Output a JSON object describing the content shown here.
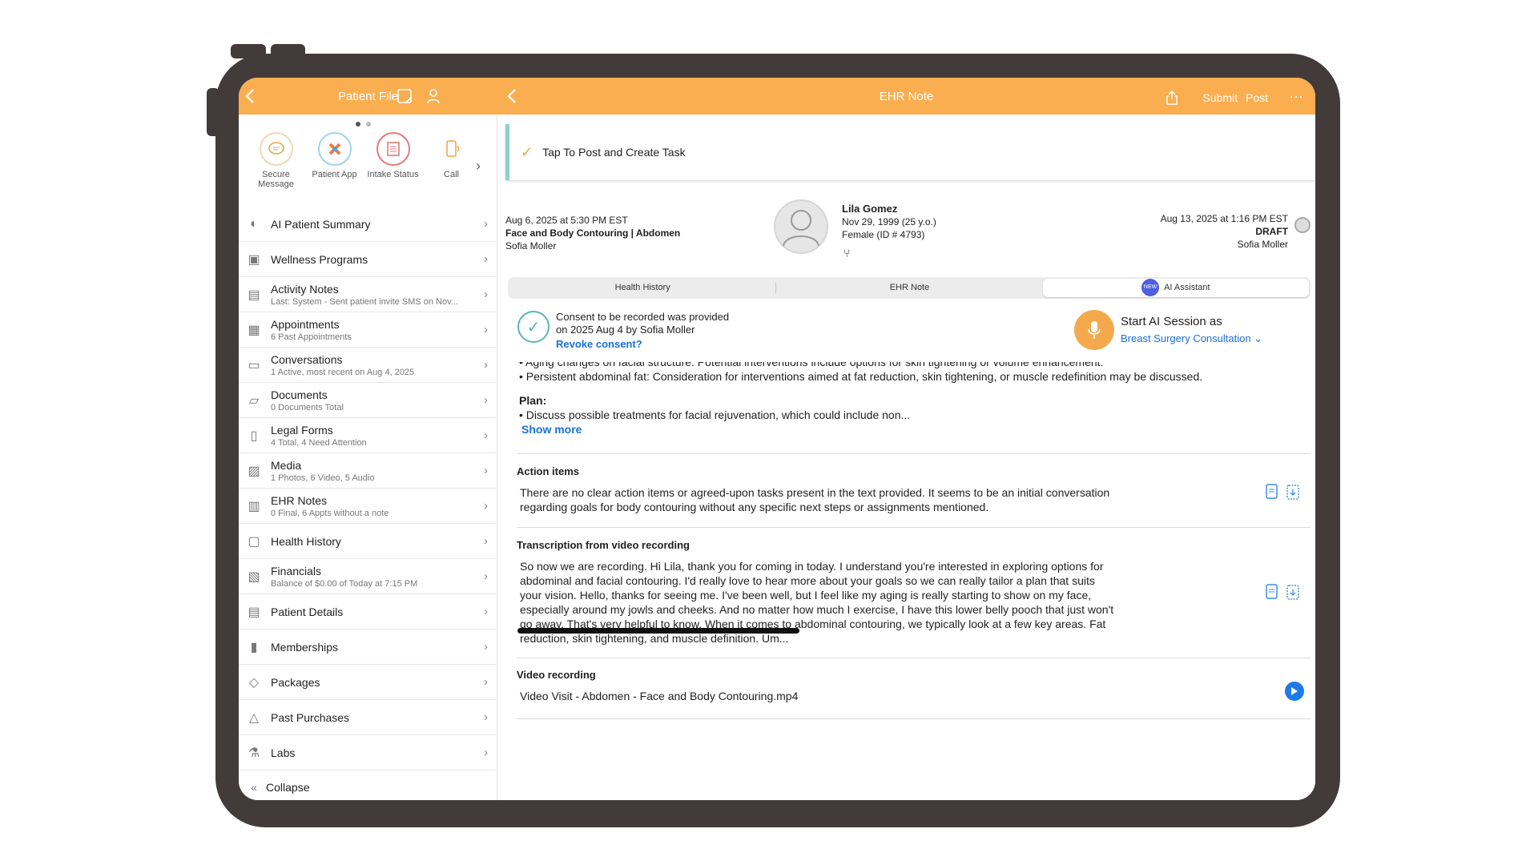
{
  "left": {
    "title": "Patient File",
    "quick_actions": [
      {
        "label": "Secure Message",
        "icon": "message-bubble-icon"
      },
      {
        "label": "Patient App",
        "icon": "patient-app-icon"
      },
      {
        "label": "Intake Status",
        "icon": "intake-form-icon"
      },
      {
        "label": "Call",
        "icon": "phone-icon"
      }
    ],
    "menu": [
      {
        "label": "AI Patient Summary",
        "sub": ""
      },
      {
        "label": "Wellness Programs",
        "sub": ""
      },
      {
        "label": "Activity Notes",
        "sub": "Last: System - Sent patient invite SMS on Nov..."
      },
      {
        "label": "Appointments",
        "sub": "6 Past Appointments"
      },
      {
        "label": "Conversations",
        "sub": "1 Active, most recent on Aug 4, 2025"
      },
      {
        "label": "Documents",
        "sub": "0 Documents Total"
      },
      {
        "label": "Legal Forms",
        "sub": "4 Total, 4 Need Attention"
      },
      {
        "label": "Media",
        "sub": "1 Photos, 6 Video, 5 Audio"
      },
      {
        "label": "EHR Notes",
        "sub": "0 Final, 6 Appts without a note"
      },
      {
        "label": "Health History",
        "sub": ""
      },
      {
        "label": "Financials",
        "sub": "Balance of $0.00 of Today at 7:15 PM"
      },
      {
        "label": "Patient Details",
        "sub": ""
      },
      {
        "label": "Memberships",
        "sub": ""
      },
      {
        "label": "Packages",
        "sub": ""
      },
      {
        "label": "Past Purchases",
        "sub": ""
      },
      {
        "label": "Labs",
        "sub": ""
      }
    ],
    "collapse_label": "Collapse"
  },
  "right": {
    "title": "EHR Note",
    "submit_label": "Submit",
    "post_label": "Post",
    "post_task_label": "Tap To Post and Create Task",
    "encounter": {
      "datetime": "Aug 6, 2025 at 5:30 PM EST",
      "type": "Face and Body Contouring | Abdomen",
      "provider": "Sofia Moller"
    },
    "patient": {
      "name": "Lila Gomez",
      "dob": "Nov 29, 1999 (25 y.o.)",
      "gender_id": "Female (ID # 4793)"
    },
    "note_meta": {
      "datetime": "Aug 13, 2025 at 1:16 PM EST",
      "status": "DRAFT",
      "author": "Sofia Moller"
    },
    "tabs": [
      "Health History",
      "EHR Note",
      "AI Assistant"
    ],
    "new_badge": "NEW",
    "consent": {
      "line1": "Consent to be recorded was provided",
      "line2": "on 2025 Aug 4 by Sofia Moller",
      "revoke": "Revoke consent?"
    },
    "ai_session": {
      "title": "Start AI Session as",
      "selection": "Breast Surgery Consultation"
    },
    "summary": {
      "cut_line": "• Aging changes on facial structure: Potential interventions include options for skin tightening or volume enhancement.",
      "bullet": "• Persistent abdominal fat: Consideration for interventions aimed at fat reduction, skin tightening, or muscle redefinition may be discussed.",
      "plan_heading": "Plan:",
      "plan_bullet": "• Discuss possible treatments for facial rejuvenation, which could include non...",
      "show_more": "Show more"
    },
    "action_items": {
      "heading": "Action items",
      "body": "There are no clear action items or agreed-upon tasks present in the text provided. It seems to be an initial conversation regarding goals for body contouring without any specific next steps or assignments mentioned."
    },
    "transcription": {
      "heading": "Transcription from video recording",
      "body": "So now we are recording. Hi Lila, thank you for coming in today. I understand you're interested in exploring options for abdominal and facial contouring. I'd really love to hear more about your goals so we can really tailor a plan that suits your vision. Hello, thanks for seeing me. I've been well, but I feel like my aging is really starting to show on my face, especially around my jowls and cheeks. And no matter how much I exercise, I have this lower belly pooch that just won't go away. That's very helpful to know. When it comes to abdominal contouring, we typically look at a few key areas. Fat reduction, skin tightening, and muscle definition. Um..."
    },
    "video": {
      "heading": "Video recording",
      "file": "Video Visit - Abdomen - Face and Body Contouring.mp4"
    }
  },
  "colors": {
    "accent": "#fbae4f",
    "link": "#1a6fd6",
    "teal": "#5ab9ad",
    "device": "#433b3a"
  }
}
